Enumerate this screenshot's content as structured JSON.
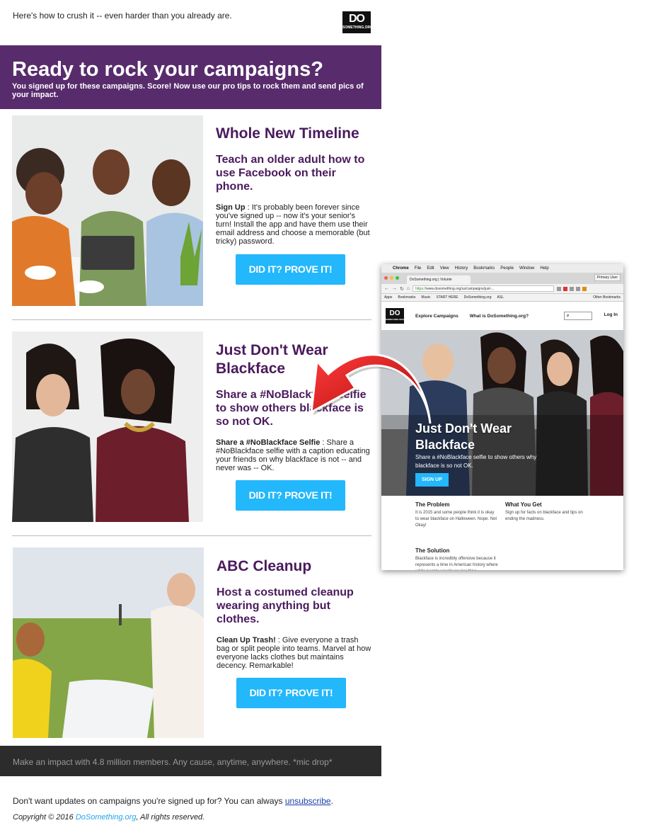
{
  "preheader": "Here's how to crush it -- even harder than you already are.",
  "logo": {
    "line1": "DO",
    "line2": "SOMETHING.ORG"
  },
  "hero": {
    "title": "Ready to rock your campaigns?",
    "subtitle": "You signed up for these campaigns. Score! Now use our pro tips to rock them and send pics of your impact."
  },
  "campaigns": [
    {
      "title": "Whole New Timeline",
      "subtitle": "Teach an older adult how to use Facebook on their phone.",
      "body_label": "Sign Up",
      "body_text": " : It's probably been forever since you've signed up -- now it's your senior's turn! Install the app and have them use their email address and choose a memorable (but tricky) password.",
      "button": "DID IT? PROVE IT!"
    },
    {
      "title": "Just Don't Wear Blackface",
      "subtitle": "Share a #NoBlackface selfie to show others blackface is so not OK.",
      "body_label": "Share a #NoBlackface Selfie",
      "body_text": " : Share a #NoBlackface selfie with a caption educating your friends on why blackface is not -- and never was -- OK.",
      "button": "DID IT? PROVE IT!"
    },
    {
      "title": "ABC Cleanup",
      "subtitle": "Host a costumed cleanup wearing anything but clothes.",
      "body_label": "Clean Up Trash!",
      "body_text": " : Give everyone a trash bag or split people into teams. Marvel at how everyone lacks clothes but maintains decency. Remarkable!",
      "button": "DID IT? PROVE IT!"
    }
  ],
  "footer": {
    "tagline": "Make an impact with 4.8 million members. Any cause, anytime, anywhere. *mic drop*",
    "unsub_text": "Don't want updates on campaigns you're signed up for? You can always ",
    "unsub_link": "unsubscribe",
    "unsub_end": ".",
    "copyright_prefix": "Copyright © 2016 ",
    "copyright_link": "DoSomething.org",
    "copyright_suffix": ", All rights reserved."
  },
  "screenshot": {
    "menu": {
      "apple": "",
      "app": "Chrome",
      "items": [
        "File",
        "Edit",
        "View",
        "History",
        "Bookmarks",
        "People",
        "Window",
        "Help"
      ]
    },
    "tab_title": "DoSomething.org | Volunte",
    "primary_user": "Primary User",
    "url_scheme": "https://",
    "url_rest": "www.dosomething.org/us/campaigns/just-...",
    "bookmarks": [
      "Apps",
      "Bookmarks",
      "Music",
      "START HERE",
      "DoSomething.org",
      "ASL",
      "Other Bookmarks"
    ],
    "site_logo": "DO",
    "site_logo_sub": "SOMETHING.ORG",
    "nav_explore": "Explore Campaigns",
    "nav_what": "What is DoSomething.org?",
    "search_icon": "⌕",
    "nav_login": "Log In",
    "hero_title": "Just Don't Wear Blackface",
    "hero_sub": "Share a #NoBlackface selfie to show others why blackface is so not OK.",
    "hero_button": "SIGN UP",
    "problem_h": "The Problem",
    "problem_p": "It is 2015 and some people think it is okay to wear blackface on Halloween. Nope. Not Okay!",
    "get_h": "What You Get",
    "get_p": "Sign up for facts on blackface and tips on ending the madness.",
    "solution_h": "The Solution",
    "solution_p": "Blackface is incredibly offensive because it represents a time in American history where white people would use insulting"
  },
  "colors": {
    "purple": "#582c6c",
    "title_purple": "#4a1a5c",
    "button_blue": "#23b7fb",
    "dark_footer": "#2c2c2c",
    "arrow_red": "#d31414"
  }
}
